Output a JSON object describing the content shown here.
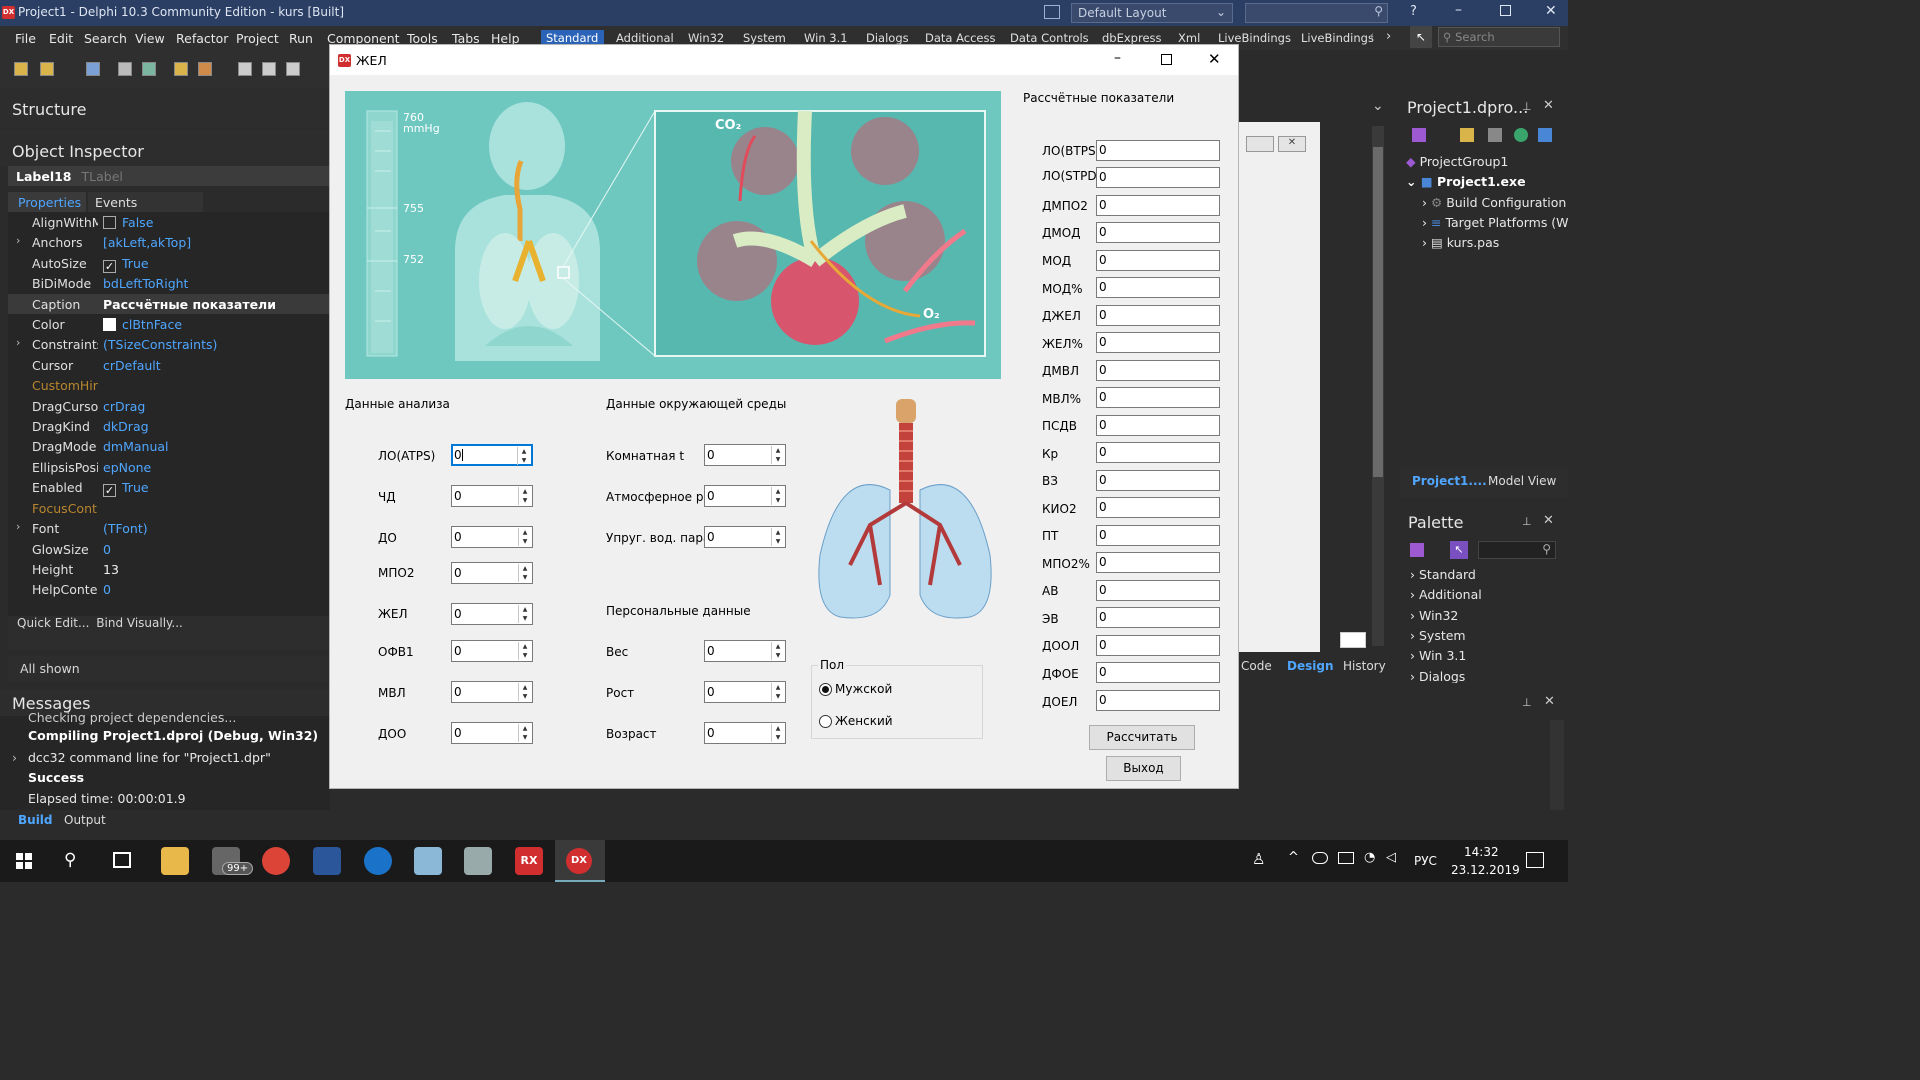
{
  "ide": {
    "title": "Project1 - Delphi 10.3 Community Edition - kurs [Built]",
    "layout_select": "Default Layout",
    "menu": [
      "File",
      "Edit",
      "Search",
      "View",
      "Refactor",
      "Project",
      "Run",
      "Component",
      "Tools",
      "Tabs",
      "Help"
    ],
    "palette_tabs": [
      "Standard",
      "Additional",
      "Win32",
      "System",
      "Win 3.1",
      "Dialogs",
      "Data Access",
      "Data Controls",
      "dbExpress",
      "Xml",
      "LiveBindings",
      "LiveBindings"
    ],
    "palette_active": "Standard",
    "search_placeholder": "Search",
    "structure_title": "Structure",
    "object_inspector": {
      "title": "Object Inspector",
      "selected_name": "Label18",
      "selected_type": "TLabel",
      "tab_properties": "Properties",
      "tab_events": "Events",
      "rows": [
        {
          "name": "AlignWithM",
          "value": "False"
        },
        {
          "name": "Anchors",
          "value": "[akLeft,akTop]"
        },
        {
          "name": "AutoSize",
          "value": "True"
        },
        {
          "name": "BiDiMode",
          "value": "bdLeftToRight"
        },
        {
          "name": "Caption",
          "value": "Рассчётные показатели"
        },
        {
          "name": "Color",
          "value": "clBtnFace"
        },
        {
          "name": "Constraints",
          "value": "(TSizeConstraints)"
        },
        {
          "name": "Cursor",
          "value": "crDefault"
        },
        {
          "name": "CustomHir",
          "value": ""
        },
        {
          "name": "DragCursor",
          "value": "crDrag"
        },
        {
          "name": "DragKind",
          "value": "dkDrag"
        },
        {
          "name": "DragMode",
          "value": "dmManual"
        },
        {
          "name": "EllipsisPosi",
          "value": "epNone"
        },
        {
          "name": "Enabled",
          "value": "True"
        },
        {
          "name": "FocusCont",
          "value": ""
        },
        {
          "name": "Font",
          "value": "(TFont)"
        },
        {
          "name": "GlowSize",
          "value": "0"
        },
        {
          "name": "Height",
          "value": "13"
        },
        {
          "name": "HelpConte",
          "value": "0"
        }
      ],
      "quick_edit": "Quick Edit...",
      "bind_visually": "Bind Visually...",
      "all_shown": "All shown"
    },
    "messages": {
      "title": "Messages",
      "lines": [
        "Checking project dependencies...",
        "Compiling Project1.dproj (Debug, Win32)",
        "dcc32 command line for \"Project1.dpr\"",
        "Success",
        "Elapsed time: 00:00:01.9"
      ],
      "tab_build": "Build",
      "tab_output": "Output"
    },
    "project": {
      "title": "Project1.dpro...",
      "items": [
        "ProjectGroup1",
        "Project1.exe",
        "Build Configuration",
        "Target Platforms (W",
        "kurs.pas"
      ],
      "tab_project": "Project1....",
      "tab_model": "Model View"
    },
    "palette": {
      "title": "Palette",
      "items": [
        "Standard",
        "Additional",
        "Win32",
        "System",
        "Win 3.1",
        "Dialogs"
      ]
    },
    "designer_tabs": [
      "Code",
      "Design",
      "History"
    ],
    "tray": {
      "lang": "РУС",
      "time": "14:32",
      "date": "23.12.2019",
      "badge": "99+"
    }
  },
  "dialog": {
    "title": "ЖЕЛ",
    "image_labels": {
      "p760": "760",
      "mmhg": "mmHg",
      "p755": "755",
      "p752": "752",
      "co2": "CO₂",
      "o2": "O₂"
    },
    "group_analysis": "Данные анализа",
    "group_env": "Данные окружающей среды",
    "group_personal": "Персональные данные",
    "group_results": "Рассчётные показатели",
    "group_sex": "Пол",
    "analysis": [
      {
        "label": "ЛО(ATPS)",
        "value": "0"
      },
      {
        "label": "ЧД",
        "value": "0"
      },
      {
        "label": "ДО",
        "value": "0"
      },
      {
        "label": "МПО2",
        "value": "0"
      },
      {
        "label": "ЖЕЛ",
        "value": "0"
      },
      {
        "label": "ОФВ1",
        "value": "0"
      },
      {
        "label": "МВЛ",
        "value": "0"
      },
      {
        "label": "ДОО",
        "value": "0"
      }
    ],
    "env": [
      {
        "label": "Комнатная t",
        "value": "0"
      },
      {
        "label": "Атмосферное р",
        "value": "0"
      },
      {
        "label": "Упруг. вод. пара",
        "value": "0"
      }
    ],
    "personal": [
      {
        "label": "Вес",
        "value": "0"
      },
      {
        "label": "Рост",
        "value": "0"
      },
      {
        "label": "Возраст",
        "value": "0"
      }
    ],
    "sex_male": "Мужской",
    "sex_female": "Женский",
    "results": [
      {
        "label": "ЛО(BTPS)",
        "value": "0"
      },
      {
        "label": "ЛО(STPD)",
        "value": "0"
      },
      {
        "label": "ДМПО2",
        "value": "0"
      },
      {
        "label": "ДМОД",
        "value": "0"
      },
      {
        "label": "МОД",
        "value": "0"
      },
      {
        "label": "МОД%",
        "value": "0"
      },
      {
        "label": "ДЖЕЛ",
        "value": "0"
      },
      {
        "label": "ЖЕЛ%",
        "value": "0"
      },
      {
        "label": "ДМВЛ",
        "value": "0"
      },
      {
        "label": "МВЛ%",
        "value": "0"
      },
      {
        "label": "ПСДВ",
        "value": "0"
      },
      {
        "label": "Кр",
        "value": "0"
      },
      {
        "label": "ВЗ",
        "value": "0"
      },
      {
        "label": "КИО2",
        "value": "0"
      },
      {
        "label": "ПТ",
        "value": "0"
      },
      {
        "label": "МПО2%",
        "value": "0"
      },
      {
        "label": "АВ",
        "value": "0"
      },
      {
        "label": "ЭВ",
        "value": "0"
      },
      {
        "label": "ДООЛ",
        "value": "0"
      },
      {
        "label": "ДФОЕ",
        "value": "0"
      },
      {
        "label": "ДОЕЛ",
        "value": "0"
      }
    ],
    "btn_calc": "Рассчитать",
    "btn_exit": "Выход"
  }
}
